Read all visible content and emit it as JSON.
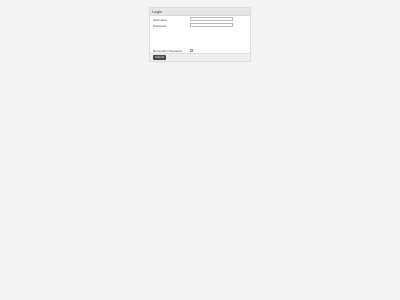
{
  "login": {
    "title": "Login",
    "username_label": "Username",
    "username_value": "",
    "password_label": "Password",
    "password_value": "",
    "remember_label": "Remember Password",
    "remember_checked": false,
    "submit_label": "Submit"
  }
}
